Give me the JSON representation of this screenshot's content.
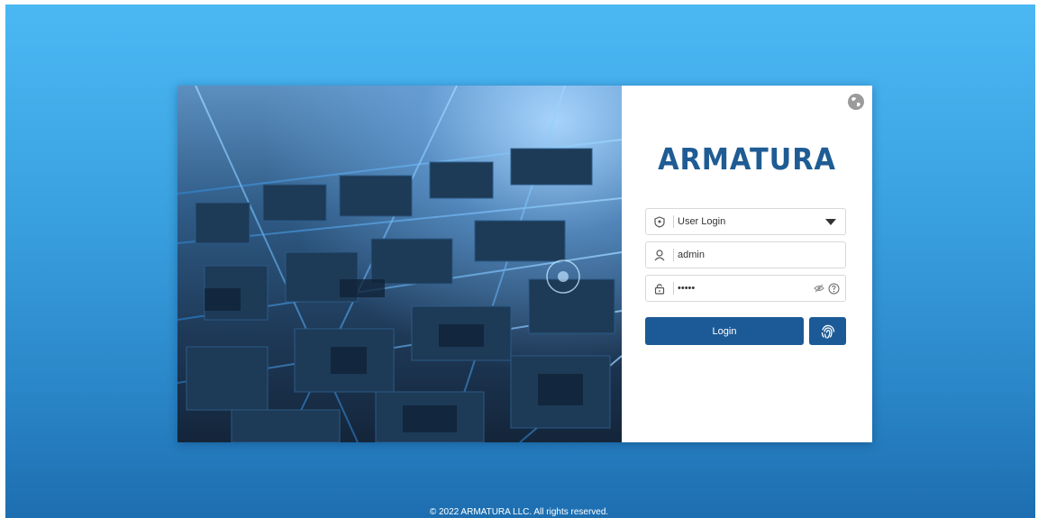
{
  "panel": {
    "brand": "ARMATURA",
    "login_type": {
      "selected": "User Login"
    },
    "username": {
      "value": "admin"
    },
    "password": {
      "value": "admin"
    },
    "login_label": "Login"
  },
  "icons": {
    "language": "globe-icon",
    "login_type": "shield-icon",
    "user": "user-icon",
    "lock": "lock-icon",
    "show_password": "eye-off-icon",
    "help": "question-circle-icon",
    "dropdown": "caret-down-icon",
    "fingerprint": "fingerprint-icon"
  },
  "colors": {
    "brand": "#1f5c94",
    "button": "#1c5a97",
    "background_top": "#4bb8f4",
    "background_bottom": "#1d6eb0"
  },
  "footer": {
    "copyright": "© 2022 ARMATURA LLC. All rights reserved."
  }
}
